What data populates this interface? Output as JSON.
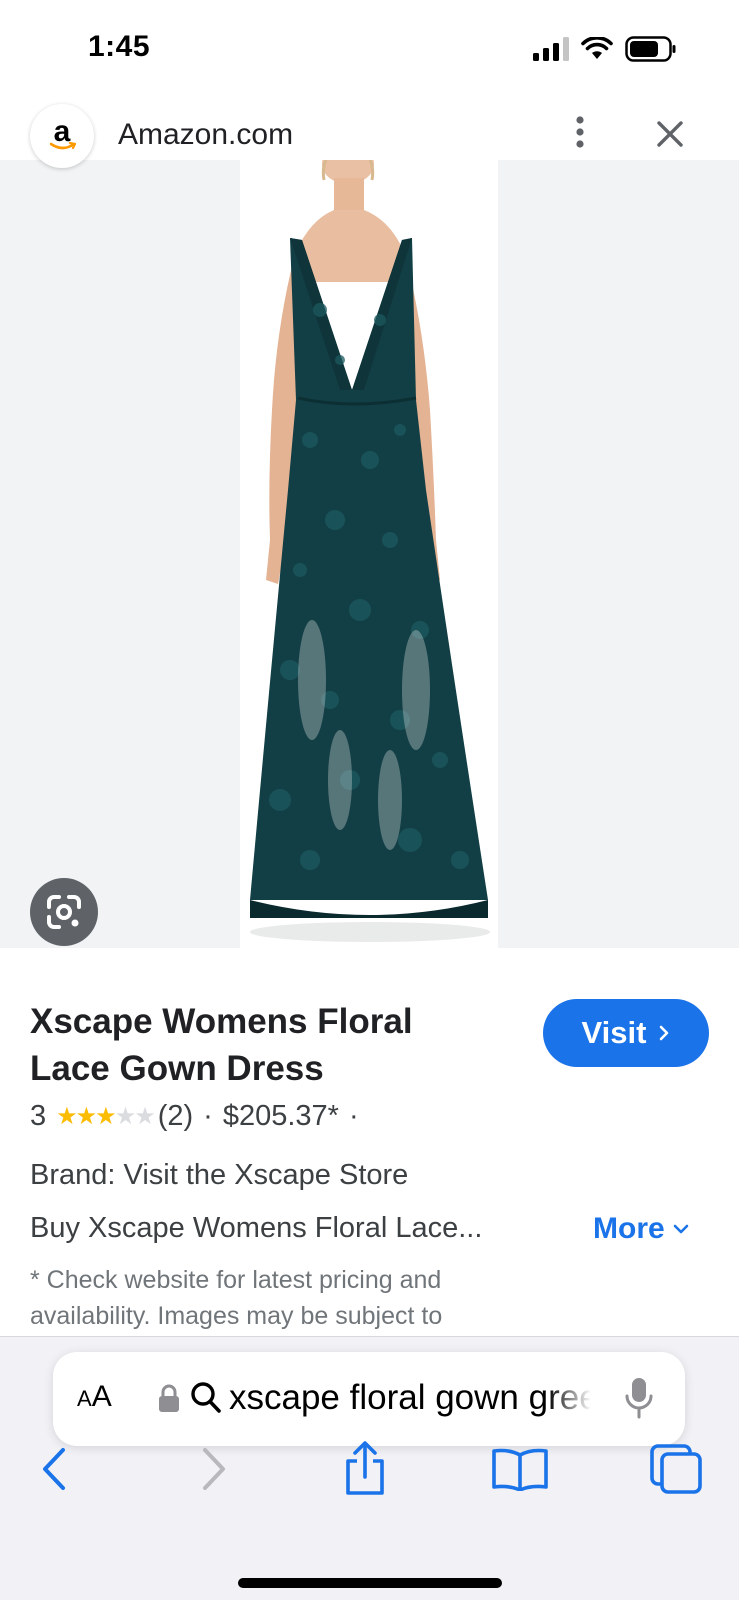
{
  "status_bar": {
    "time": "1:45"
  },
  "header": {
    "favicon_letter": "a",
    "site_name": "Amazon.com"
  },
  "product": {
    "title": "Xscape Womens Floral Lace Gown Dress",
    "visit_label": "Visit",
    "rating_value": "3",
    "rating_stars": 3,
    "rating_max": 5,
    "review_count": "(2)",
    "separator": "·",
    "price": "$205.37*",
    "brand": "Brand: Visit the Xscape Store",
    "description": "Buy Xscape Womens Floral Lace...",
    "more_label": "More",
    "disclaimer": "* Check website for latest pricing and availability. Images may be subject to"
  },
  "browser": {
    "aa_label": "A",
    "aa_label_large": "A",
    "url_text": "xscape floral gown green"
  },
  "colors": {
    "accent": "#1a73e8",
    "star": "#fbbc04",
    "dress": "#123f45",
    "hero_bg": "#f1f3f4"
  },
  "icons": {
    "header": [
      "more-vert-icon",
      "close-icon"
    ],
    "image": [
      "google-lens-icon"
    ],
    "toolbar": [
      "back-icon",
      "forward-icon",
      "share-icon",
      "bookmarks-icon",
      "tabs-icon"
    ]
  }
}
